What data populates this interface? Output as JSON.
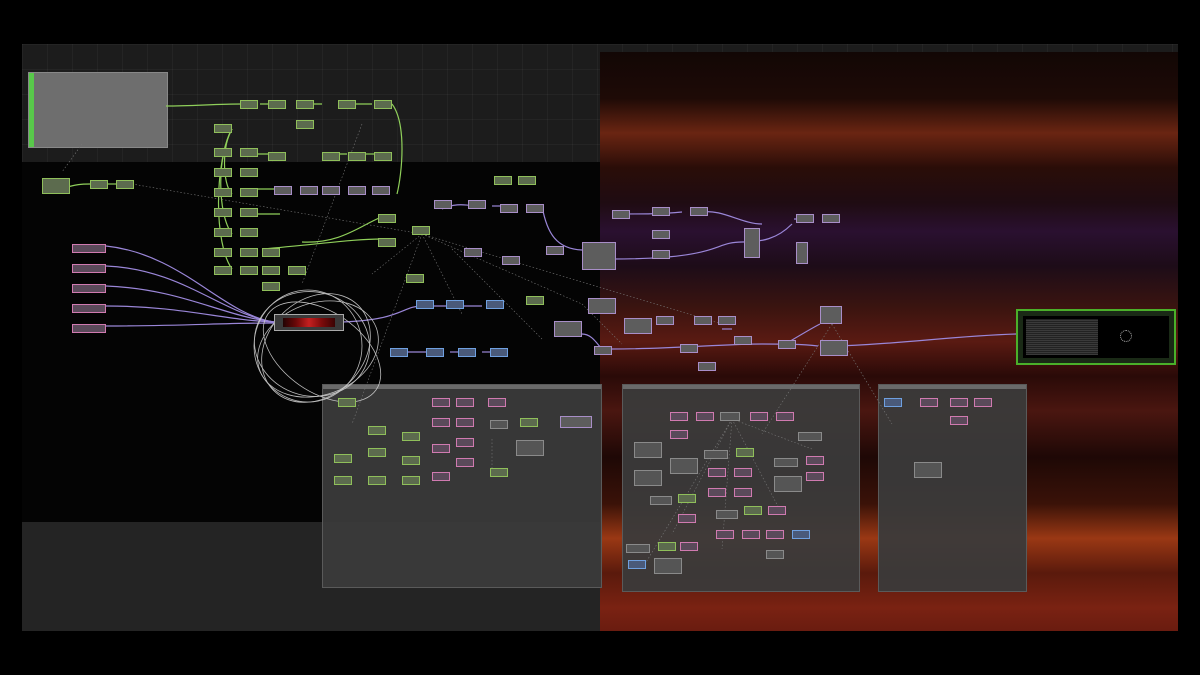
{
  "app": {
    "name": "",
    "background_color": "#000000",
    "network_color": "#1c1c1c"
  },
  "containers": [
    {
      "id": "top-panel-comp",
      "label": ""
    },
    {
      "id": "bottom-center-comp",
      "label": ""
    },
    {
      "id": "bottom-right-comp",
      "label": ""
    },
    {
      "id": "far-right-comp",
      "label": ""
    }
  ],
  "operator_colors": {
    "chop": "#8fbf5a",
    "top": "#a88ec8",
    "sop": "#6fa0e0",
    "dat": "#d07ab0",
    "wire_chop": "#8fcf5a",
    "wire_top": "#9a86d8",
    "output_border": "#4ab02a"
  },
  "icons": [
    "ramp-preview-icon",
    "output-preview-icon",
    "circle-sop-icon"
  ]
}
